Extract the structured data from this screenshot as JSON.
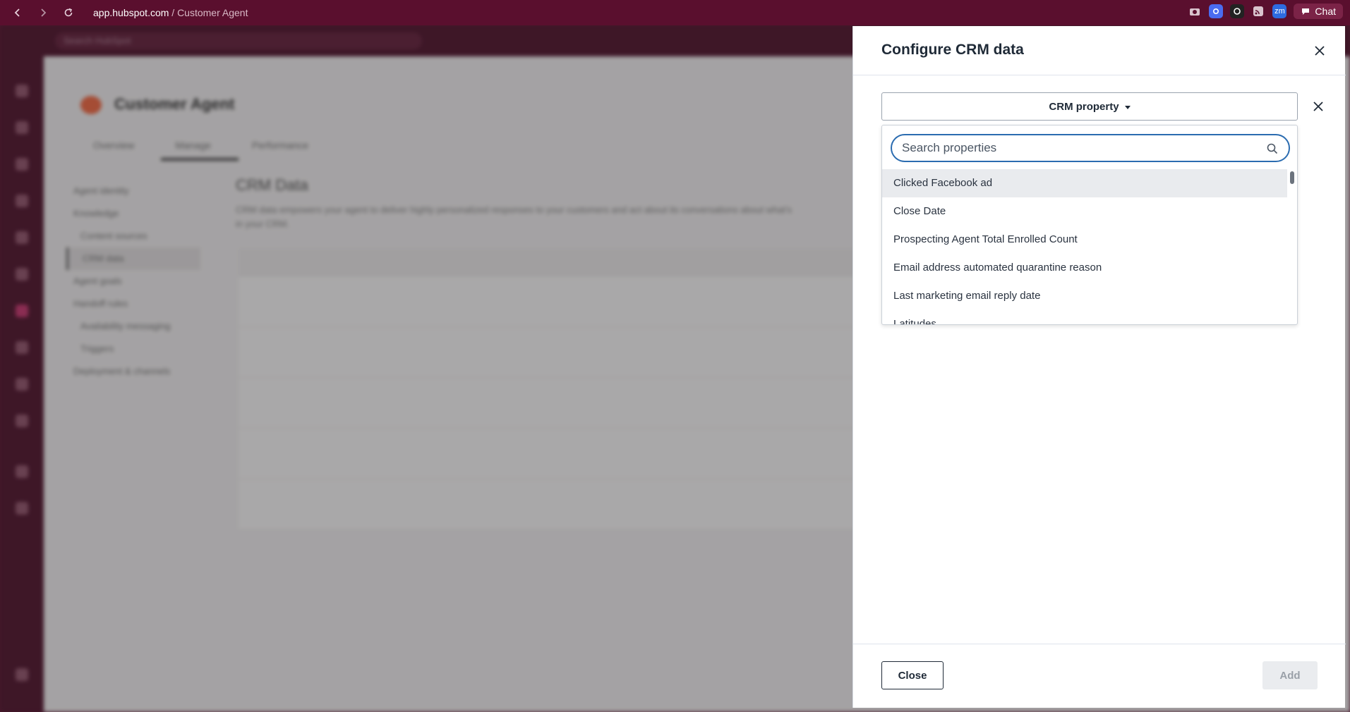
{
  "browser": {
    "url_host": "app.hubspot.com",
    "url_path": " / Customer Agent",
    "chat_label": "Chat",
    "ext_zm": "zm"
  },
  "background": {
    "search_placeholder": "Search HubSpot",
    "page_title": "Customer Agent",
    "tabs": [
      "Overview",
      "Manage",
      "Performance"
    ],
    "side_items": [
      "Agent identity",
      "Knowledge",
      "Content sources",
      "CRM data",
      "Agent goals",
      "Handoff rules",
      "Availability messaging",
      "Triggers",
      "Deployment & channels"
    ],
    "section_title": "CRM Data",
    "section_desc": "CRM data empowers your agent to deliver highly personalized responses to your customers and act about its conversations about what's in your CRM."
  },
  "panel": {
    "title": "Configure CRM data",
    "property_select_label": "CRM property",
    "search_placeholder": "Search properties",
    "options": [
      "Clicked Facebook ad",
      "Close Date",
      "Prospecting Agent Total Enrolled Count",
      "Email address automated quarantine reason",
      "Last marketing email reply date",
      "Latitudes"
    ],
    "close_label": "Close",
    "add_label": "Add"
  },
  "colors": {
    "chrome_bg": "#5a0f2e",
    "focus_blue": "#2b6cb0",
    "text_dark": "#1f2a37"
  }
}
